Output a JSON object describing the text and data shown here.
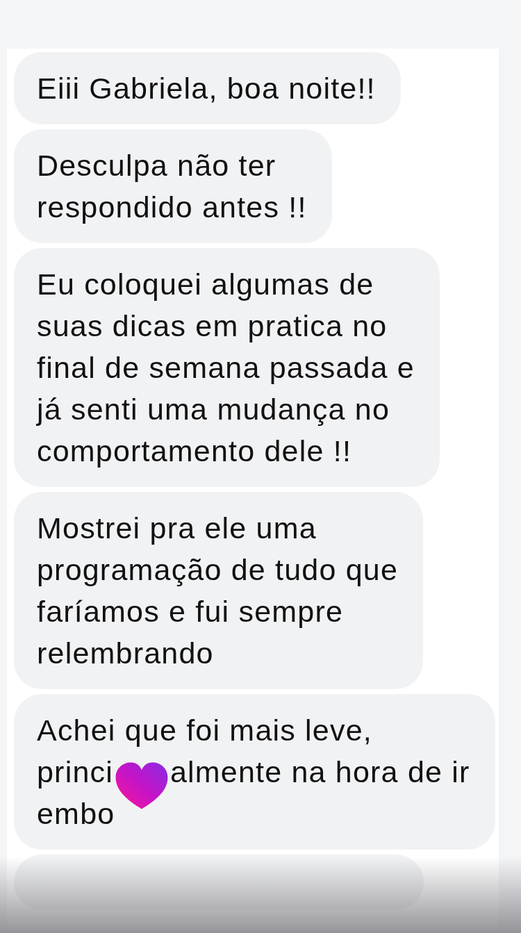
{
  "messages": [
    {
      "lines": [
        [
          "Eiii Gabriela, boa noite!!"
        ]
      ]
    },
    {
      "lines": [
        [
          "Desculpa não ter"
        ],
        [
          "respondido antes !!"
        ]
      ]
    },
    {
      "lines": [
        [
          "Eu coloquei algumas de"
        ],
        [
          "suas dicas em pratica no"
        ],
        [
          "final de semana passada e"
        ],
        [
          "já senti uma mudança no"
        ],
        [
          "comportamento dele !!"
        ]
      ]
    },
    {
      "lines": [
        [
          "Mostrei pra ele uma"
        ],
        [
          "programação de tudo que"
        ],
        [
          "faríamos e fui sempre"
        ],
        [
          "relembrando"
        ]
      ]
    },
    {
      "lines": [
        [
          "Achei que foi mais leve,"
        ],
        [
          "princi",
          "almente na hora de ir"
        ],
        [
          "embo"
        ]
      ],
      "covered": true
    }
  ]
}
